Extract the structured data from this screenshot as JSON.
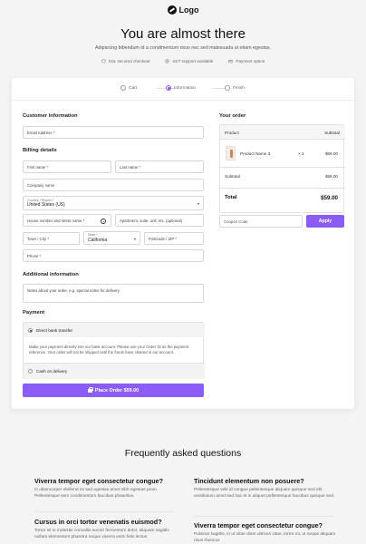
{
  "header": {
    "logo_text": "Logo",
    "title": "You are almost there",
    "subtitle": "Adipiscing bibendum id a condimentum risus nec sed malesuada ut etiam egestas.",
    "features": [
      {
        "icon": "shield-icon",
        "label": "SSL secured checkout"
      },
      {
        "icon": "support-icon",
        "label": "24/7 support available"
      },
      {
        "icon": "card-icon",
        "label": "Payment option"
      }
    ]
  },
  "steps": {
    "items": [
      {
        "label": "Cart",
        "active": false
      },
      {
        "label": "Information",
        "active": true
      },
      {
        "label": "Finish",
        "active": false
      }
    ]
  },
  "form": {
    "customer_heading": "Customer information",
    "email_placeholder": "Email Address *",
    "billing_heading": "Billing details",
    "first_name_placeholder": "First name *",
    "last_name_placeholder": "Last name *",
    "company_placeholder": "Company name",
    "country_label": "Country / Region *",
    "country_value": "United States (US)",
    "address_placeholder": "House number and street name *",
    "apartment_placeholder": "Apartment, suite, unit, etc. (optional)",
    "city_placeholder": "Town / City *",
    "state_label": "State *",
    "state_value": "California",
    "postcode_placeholder": "Postcode / ZIP *",
    "phone_placeholder": "Phone *",
    "additional_heading": "Additional information",
    "notes_placeholder": "Notes about your order, e.g. special notes for delivery.",
    "payment_heading": "Payment",
    "payment_option_1": "Direct bank transfer",
    "payment_desc": "Make your payment directly into our bank account. Please use your Order ID as the payment reference. Your order will not be shipped until the funds have cleared in our account.",
    "payment_option_2": "Cash on delivery",
    "place_order_label": "Place Order  $59.00"
  },
  "order": {
    "heading": "Your order",
    "col_product": "Product",
    "col_subtotal": "Subtotal",
    "product_name": "Product Name 3",
    "product_qty": "× 1",
    "product_price": "$59.00",
    "subtotal_label": "Subtotal",
    "subtotal_value": "$59.00",
    "total_label": "Total",
    "total_value": "$59.00",
    "coupon_placeholder": "Coupon Code",
    "apply_label": "Apply"
  },
  "faq": {
    "title": "Frequently asked questions",
    "items": [
      {
        "q": "Viverra tempor eget consectetur congue?",
        "a": "In ullamcorper eleifend mi sed egestas amet nibh egestas proin. Pellentesque sem condimentum faucibus phasellus."
      },
      {
        "q": "Tincidunt elementum non posuere?",
        "a": "Pellentesque velit id congue pellentesque aliquam quisque sed elit vestibulum amet sed hac et in aliquet pellentesque faucibus quisque sed."
      },
      {
        "q": "Cursus in orci tortor venenatis euismod?",
        "a": "Tortor sit in molestie convallis auctor fermentum dolor, aliquam sagittis nullam elementum pharetra neque viverra enim felis lectus"
      },
      {
        "q": "Viverra tempor eget consectetur congue?",
        "a": "Pulvinar sagittis, in ut vitae diam ultrices vitae, tortor mi, ut neque aliquam risus rhoncus"
      }
    ]
  },
  "colors": {
    "accent": "#8b5cf6",
    "background": "#f4f4f5"
  }
}
